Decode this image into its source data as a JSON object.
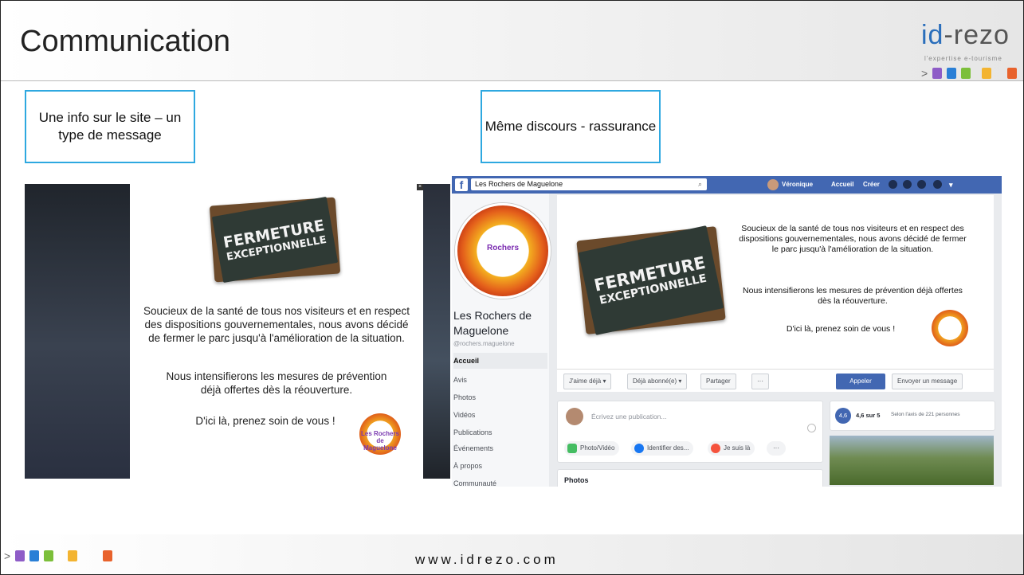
{
  "slide": {
    "title": "Communication",
    "logo": {
      "brand_a": "id",
      "brand_b": "-rezo",
      "tagline": "l'expertise e-tourisme"
    },
    "footer_url": "www.idrezo.com",
    "colors": {
      "accent_border": "#2ea8e0",
      "fb_blue": "#4267b2",
      "square_purple": "#8e5cc7",
      "square_blue": "#2a7fd6",
      "square_green": "#7cbf3a",
      "square_yellow": "#f3b431",
      "square_orange": "#e8622c"
    }
  },
  "callouts": {
    "left": "Une info sur le site – un type de message",
    "right": "Même discours - rassurance"
  },
  "website_popup": {
    "chalkboard_line1": "FERMETURE",
    "chalkboard_line2": "EXCEPTIONNELLE",
    "paragraph1": "Soucieux de la santé de tous nos visiteurs et en respect des dispositions gouvernementales, nous avons décidé de fermer le parc jusqu'à l'amélioration de la situation.",
    "paragraph2": "Nous intensifierons les mesures de prévention déjà offertes dès la réouverture.",
    "closing": "D'ici là, prenez soin de vous !",
    "badge_text": "Les Rochers de Maguelone"
  },
  "facebook": {
    "search_value": "Les Rochers de Maguelone",
    "user_name": "Véronique",
    "nav_home": "Accueil",
    "nav_create": "Créer",
    "page_name": "Les Rochers de Maguelone",
    "page_handle": "@rochers.maguelone",
    "profile_badge": "Rochers",
    "sidebar_items": [
      "Accueil",
      "Avis",
      "Photos",
      "Vidéos",
      "Publications",
      "Événements",
      "À propos",
      "Communauté"
    ],
    "cover": {
      "chalk_line1": "FERMETURE",
      "chalk_line2": "EXCEPTIONNELLE",
      "paragraph1": "Soucieux de la santé de tous nos visiteurs et en respect des dispositions gouvernementales, nous avons décidé de fermer le parc jusqu'à l'amélioration de la situation.",
      "paragraph2": "Nous intensifierons les mesures de prévention déjà offertes dès la réouverture.",
      "closing": "D'ici là, prenez soin de vous !"
    },
    "actions": {
      "like": "J'aime déjà ▾",
      "follow": "Déjà abonné(e) ▾",
      "share": "Partager",
      "more": "···",
      "call": "Appeler",
      "message": "Envoyer un message"
    },
    "composer": {
      "placeholder": "Écrivez une publication...",
      "photo": "Photo/Vidéo",
      "tag": "Identifier des...",
      "checkin": "Je suis là",
      "more": "···"
    },
    "rating": {
      "score": "4,6",
      "label": "4,6 sur 5",
      "detail": "Selon l'avis de 221 personnes"
    },
    "photos_heading": "Photos"
  }
}
